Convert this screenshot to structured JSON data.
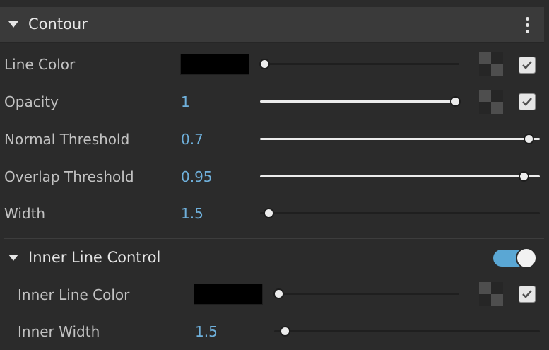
{
  "contour": {
    "title": "Contour",
    "rows": {
      "line_color": {
        "label": "Line Color",
        "slider": 0.0,
        "enabled": true
      },
      "opacity": {
        "label": "Opacity",
        "value": "1",
        "slider": 1.0,
        "enabled": true
      },
      "normal_threshold": {
        "label": "Normal Threshold",
        "value": "0.7",
        "slider": 0.99
      },
      "overlap_threshold": {
        "label": "Overlap Threshold",
        "value": "0.95",
        "slider": 0.97
      },
      "width": {
        "label": "Width",
        "value": "1.5",
        "slider": 0.02
      }
    }
  },
  "inner": {
    "title": "Inner Line Control",
    "toggle_on": true,
    "rows": {
      "inner_line_color": {
        "label": "Inner Line Color",
        "slider": 0.0,
        "enabled": true
      },
      "inner_width": {
        "label": "Inner Width",
        "value": "1.5",
        "slider": 0.03
      }
    }
  },
  "colors": {
    "accent": "#6fb0db",
    "toggle": "#5aa7d4",
    "swatch": "#000000",
    "background": "#2b2b2b"
  },
  "icons": [
    "caret-down-icon",
    "kebab-menu-icon",
    "checker-icon",
    "checkmark-icon"
  ]
}
